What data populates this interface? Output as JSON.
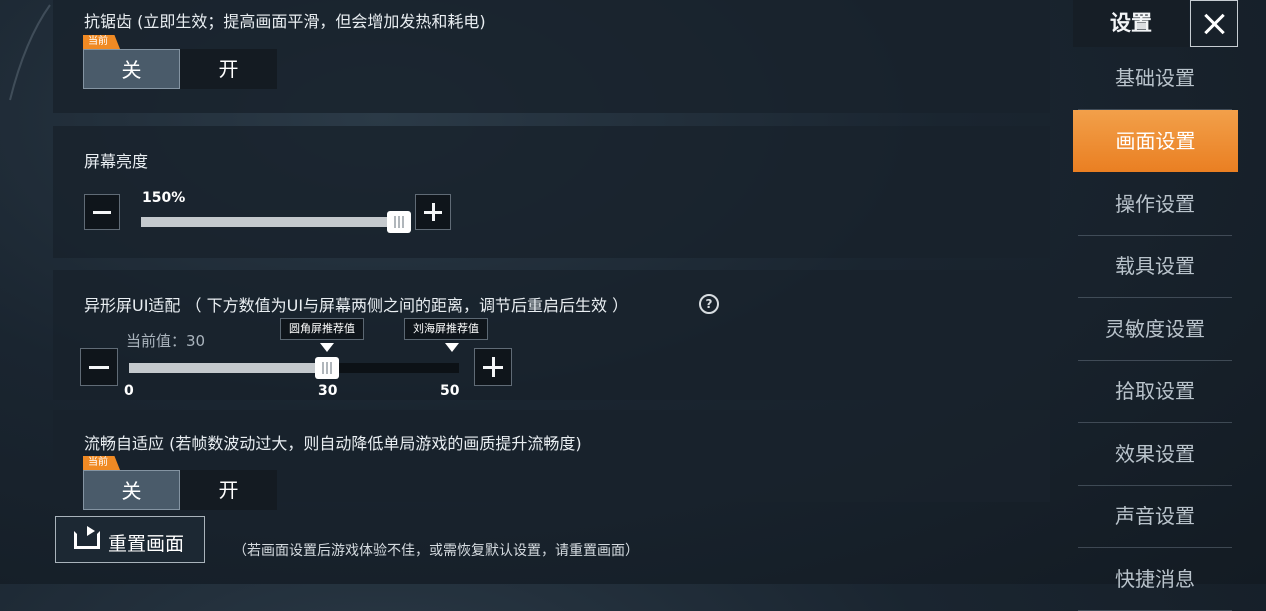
{
  "anti_aliasing": {
    "title": "抗锯齿 (立即生效；提高画面平滑，但会增加发热和耗电)",
    "badge": "当前",
    "off": "关",
    "on": "开",
    "selected": "关"
  },
  "brightness": {
    "title": "屏幕亮度",
    "value_text": "150%",
    "level_fraction": 1.0
  },
  "notch_ui": {
    "title": "异形屏UI适配 （ 下方数值为UI与屏幕两侧之间的距离，调节后重启后生效 ）",
    "help": "?",
    "current_label": "当前值：30",
    "min": "0",
    "max": "50",
    "current": 30,
    "rounded_rec_label": "圆角屏推荐值",
    "rounded_rec_value": "30",
    "notch_rec_label": "刘海屏推荐值",
    "notch_rec_value": 50
  },
  "adaptive": {
    "title": "流畅自适应 (若帧数波动过大，则自动降低单局游戏的画质提升流畅度)",
    "badge": "当前",
    "off": "关",
    "on": "开",
    "selected": "关"
  },
  "footer": {
    "reset_label": "重置画面",
    "hint": "（若画面设置后游戏体验不佳，或需恢复默认设置，请重置画面）"
  },
  "sidebar": {
    "title": "设置",
    "items": [
      {
        "label": "基础设置",
        "active": false
      },
      {
        "label": "画面设置",
        "active": true
      },
      {
        "label": "操作设置",
        "active": false
      },
      {
        "label": "载具设置",
        "active": false
      },
      {
        "label": "灵敏度设置",
        "active": false
      },
      {
        "label": "拾取设置",
        "active": false
      },
      {
        "label": "效果设置",
        "active": false
      },
      {
        "label": "声音设置",
        "active": false
      },
      {
        "label": "快捷消息",
        "active": false
      }
    ]
  },
  "colors": {
    "accent": "#ea7f22",
    "panel": "#18222c"
  }
}
